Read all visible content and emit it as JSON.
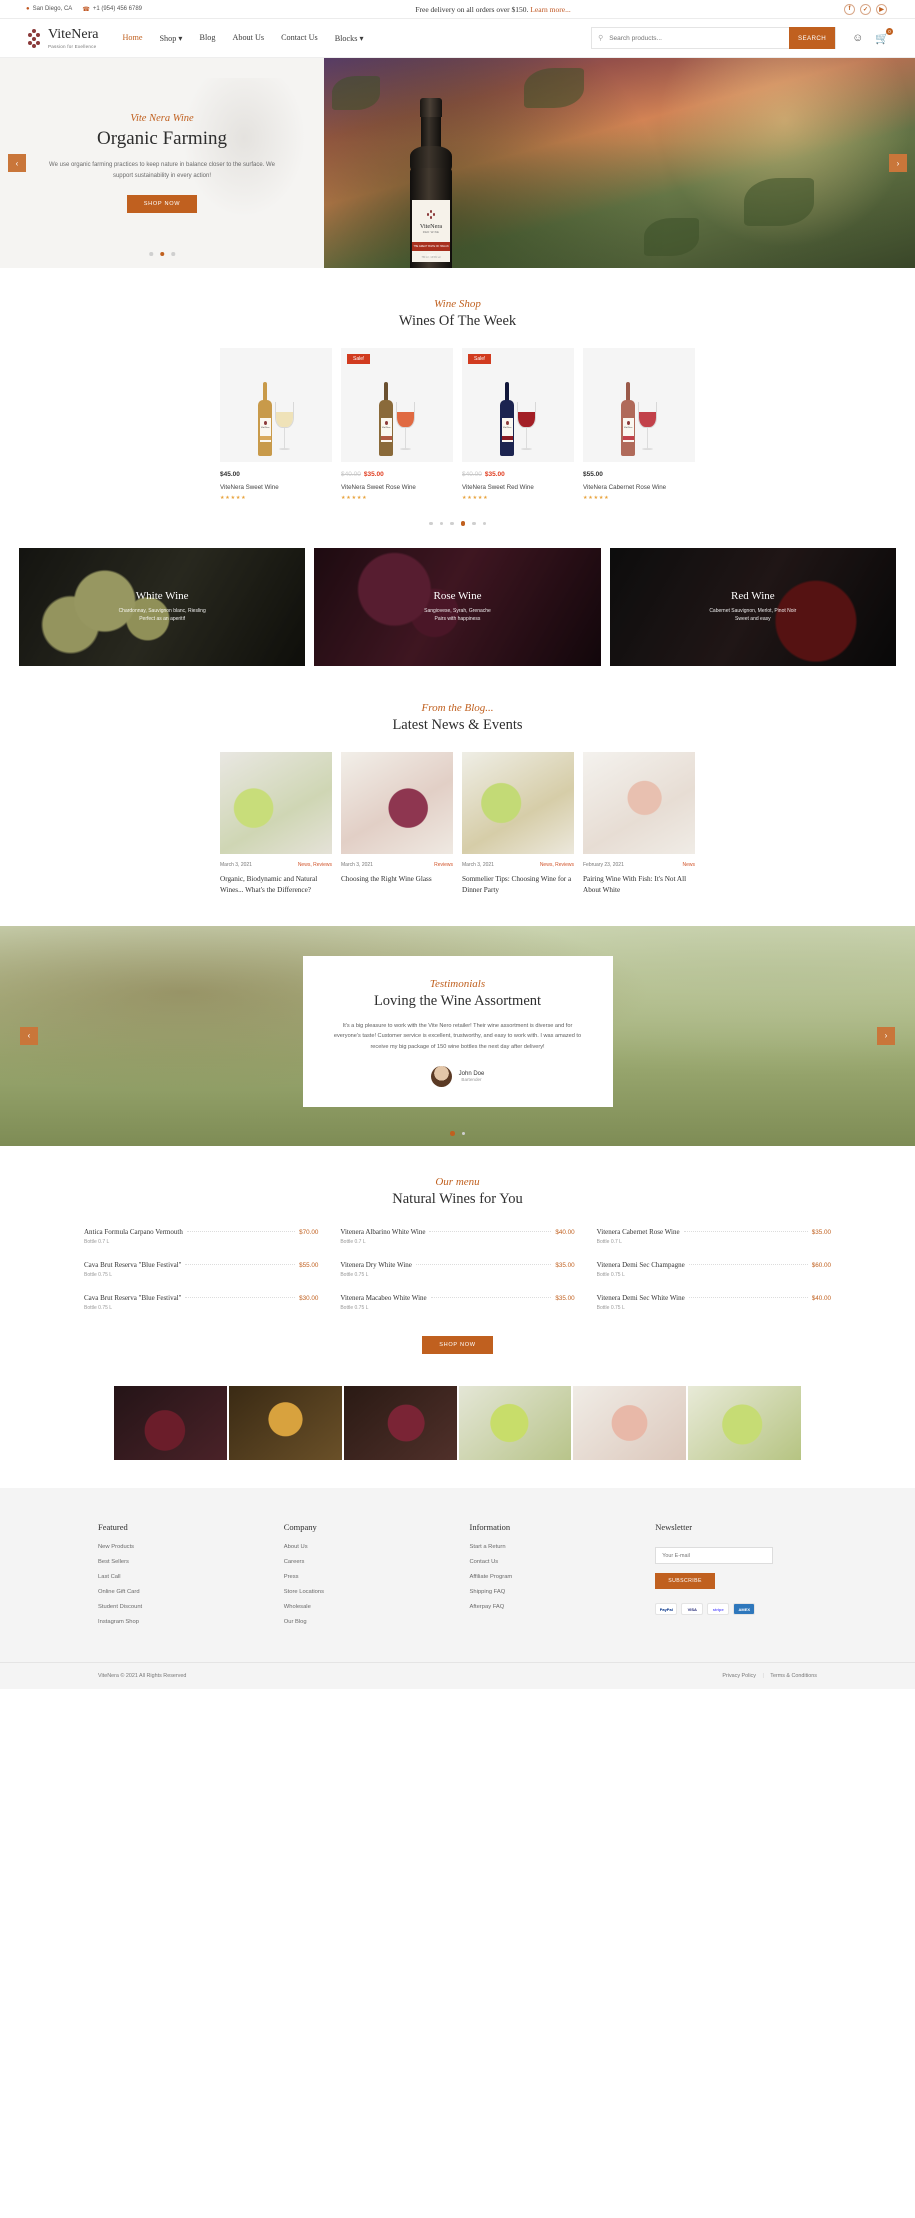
{
  "topbar": {
    "location": "San Diego, CA",
    "phone": "+1 (954) 456 6789",
    "promo": "Free delivery on all orders over $150.",
    "promo_link": "Learn more...",
    "socials": [
      {
        "name": "facebook-icon",
        "glyph": "f"
      },
      {
        "name": "twitter-icon",
        "glyph": "✓"
      },
      {
        "name": "youtube-icon",
        "glyph": "▶"
      }
    ]
  },
  "brand": {
    "name": "ViteNera",
    "tagline": "Passion for Exellence"
  },
  "nav": {
    "items": [
      {
        "label": "Home",
        "active": true
      },
      {
        "label": "Shop",
        "caret": true
      },
      {
        "label": "Blog"
      },
      {
        "label": "About Us"
      },
      {
        "label": "Contact Us"
      },
      {
        "label": "Blocks",
        "caret": true
      }
    ],
    "search_placeholder": "Search products...",
    "search_button": "SEARCH",
    "cart_count": "0"
  },
  "hero": {
    "eyebrow": "Vite Nera Wine",
    "title": "Organic Farming",
    "body": "We use organic farming practices to keep nature in balance closer to the surface. We support sustainability in every action!",
    "cta": "SHOP NOW",
    "bottle_label": {
      "name": "ViteNera",
      "sub": "RED WINE",
      "bar": "THE GREAT TASTE OF ITALIAN WINES",
      "foot": "750 ml  ·  13.5% vol"
    },
    "dots": [
      false,
      true,
      false
    ]
  },
  "shop": {
    "eyebrow": "Wine Shop",
    "title": "Wines Of The Week",
    "products": [
      {
        "price": "$45.00",
        "old": "",
        "new": "",
        "title": "ViteNera Sweet Wine",
        "stars": "★★★★★",
        "sale": "",
        "bottle": "#c89a4a",
        "wine": "#efe2b8"
      },
      {
        "price": "",
        "old": "$40.00",
        "new": "$35.00",
        "title": "ViteNera Sweet Rose Wine",
        "stars": "★★★★★",
        "sale": "Sale!",
        "bottle": "#8a6a3a",
        "wine": "#e06a42"
      },
      {
        "price": "",
        "old": "$40.00",
        "new": "$35.00",
        "title": "ViteNera Sweet Red Wine",
        "stars": "★★★★★",
        "sale": "Sale!",
        "bottle": "#1c2450",
        "wine": "#a31f26"
      },
      {
        "price": "$55.00",
        "old": "",
        "new": "",
        "title": "ViteNera Cabernet Rose Wine",
        "stars": "★★★★★",
        "sale": "",
        "bottle": "#b06a5a",
        "wine": "#c2414a"
      }
    ],
    "dots": [
      false,
      false,
      false,
      true,
      false,
      false
    ]
  },
  "categories": [
    {
      "title": "White Wine",
      "line1": "Chardonnay, Sauvignon blanc, Riesling",
      "line2": "Perfect as an aperitif"
    },
    {
      "title": "Rose Wine",
      "line1": "Sangiovese, Syrah, Grenache",
      "line2": "Pairs with happiness"
    },
    {
      "title": "Red Wine",
      "line1": "Cabernet Sauvignon, Merlot, Pinot Noir",
      "line2": "Sweet and easy"
    }
  ],
  "blog": {
    "eyebrow": "From the Blog...",
    "title": "Latest News & Events",
    "posts": [
      {
        "date": "March 3, 2021",
        "cats": "News, Reviews",
        "title": "Organic, Biodynamic and Natural Wines... What's the Difference?"
      },
      {
        "date": "March 3, 2021",
        "cats": "Reviews",
        "title": "Choosing the Right Wine Glass"
      },
      {
        "date": "March 3, 2021",
        "cats": "News, Reviews",
        "title": "Sommelier Tips: Choosing Wine for a Dinner Party"
      },
      {
        "date": "February 23, 2021",
        "cats": "News",
        "title": "Pairing Wine With Fish: It's Not All About White"
      }
    ]
  },
  "testimonials": {
    "eyebrow": "Testimonials",
    "title": "Loving the Wine Assortment",
    "quote": "It's a big pleasure to work with the Vite Nero retailer! Their wine assortment is diverse and for everyone's taste! Customer service is excellent, trustworthy, and easy to work with. I was amazed to receive my big package of 150 wine bottles the next day after delivery!",
    "author": "John Doe",
    "role": "Bartender",
    "dots": [
      true,
      false
    ]
  },
  "menu": {
    "eyebrow": "Our menu",
    "title": "Natural Wines for You",
    "columns": [
      [
        {
          "name": "Antica Formula Carpano Vermouth",
          "price": "$70.00",
          "sub": "Bottle 0.7 L"
        },
        {
          "name": "Cava Brut Reserva \"Blue Festival\"",
          "price": "$55.00",
          "sub": "Bottle 0.75 L"
        },
        {
          "name": "Cava Brut Reserva \"Blue Festival\"",
          "price": "$30.00",
          "sub": "Bottle 0.75 L"
        }
      ],
      [
        {
          "name": "Vitenera Albarino White Wine",
          "price": "$40.00",
          "sub": "Bottle 0.7 L"
        },
        {
          "name": "Vitenera Dry White Wine",
          "price": "$35.00",
          "sub": "Bottle 0.75 L"
        },
        {
          "name": "Vitenera Macabeo White Wine",
          "price": "$35.00",
          "sub": "Bottle 0.75 L"
        }
      ],
      [
        {
          "name": "Vitenera Cabernet Rose Wine",
          "price": "$35.00",
          "sub": "Bottle 0.7 L"
        },
        {
          "name": "Vitenera Demi Sec Champagne",
          "price": "$60.00",
          "sub": "Bottle 0.75 L"
        },
        {
          "name": "Vitenera Demi Sec White Wine",
          "price": "$40.00",
          "sub": "Bottle 0.75 L"
        }
      ]
    ],
    "cta": "SHOP NOW"
  },
  "footer": {
    "columns": [
      {
        "heading": "Featured",
        "links": [
          "New Products",
          "Best Sellers",
          "Last Call",
          "Online Gift Card",
          "Student Discount",
          "Instagram Shop"
        ]
      },
      {
        "heading": "Company",
        "links": [
          "About Us",
          "Careers",
          "Press",
          "Store Locations",
          "Wholesale",
          "Our Blog"
        ]
      },
      {
        "heading": "Information",
        "links": [
          "Start a Return",
          "Contact Us",
          "Affiliate Program",
          "Shipping FAQ",
          "Afterpay FAQ"
        ]
      }
    ],
    "newsletter": {
      "heading": "Newsletter",
      "placeholder": "Your E-mail",
      "button": "SUBSCRIBE"
    },
    "payments": [
      "PayPal",
      "VISA",
      "stripe",
      "AMEX"
    ],
    "copyright": "ViteNera © 2021 All Rights Reserved",
    "legal": [
      "Privacy Policy",
      "Terms & Conditions"
    ]
  },
  "colors": {
    "accent": "#c0601f",
    "sale": "#e03c1f",
    "star": "#e8a33d"
  }
}
